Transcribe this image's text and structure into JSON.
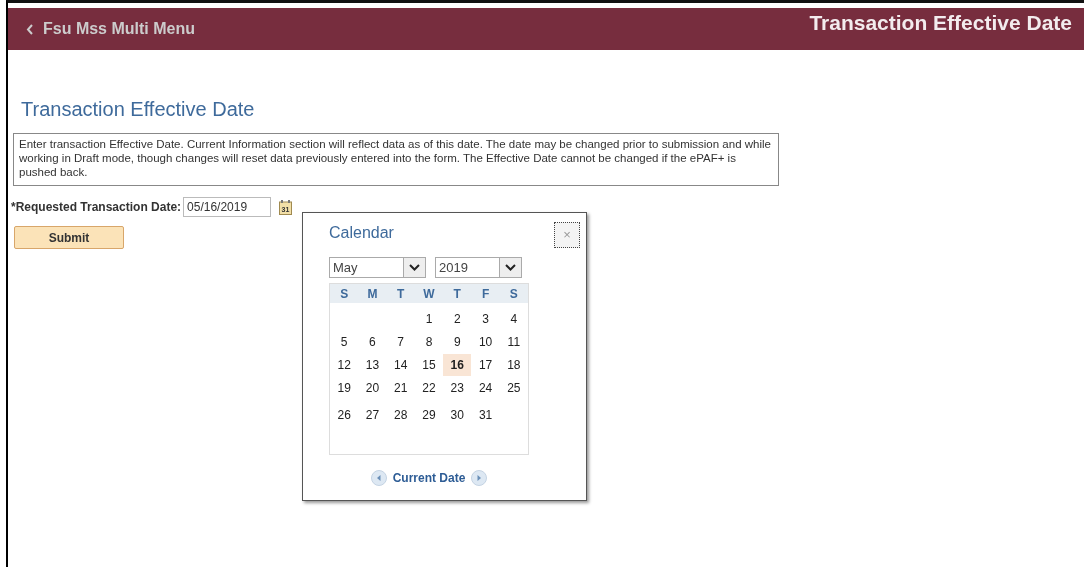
{
  "header": {
    "back_label": "Fsu Mss Multi Menu",
    "title": "Transaction Effective Date"
  },
  "page": {
    "title": "Transaction Effective Date",
    "instructions": "Enter transaction Effective Date. Current Information section will reflect data as of this date. The date may be changed prior to submission and while working in Draft mode, though changes will reset data previously entered into the form. The Effective Date cannot be changed if the ePAF+ is pushed back.",
    "date_label": "*Requested Transaction Date:",
    "date_value": "05/16/2019",
    "calendar_icon_text": "31",
    "submit": "Submit"
  },
  "calendar": {
    "title": "Calendar",
    "close": "×",
    "month": "May",
    "year": "2019",
    "weekdays": [
      "S",
      "M",
      "T",
      "W",
      "T",
      "F",
      "S"
    ],
    "weeks": [
      {
        "kind": "first",
        "days": [
          {
            "day": "1",
            "selected": false
          },
          {
            "day": "2",
            "selected": false
          },
          {
            "day": "3",
            "selected": false
          },
          {
            "day": "4",
            "selected": false
          }
        ]
      },
      {
        "kind": "middle",
        "days": [
          {
            "day": "5",
            "selected": false
          },
          {
            "day": "6",
            "selected": false
          },
          {
            "day": "7",
            "selected": false
          },
          {
            "day": "8",
            "selected": false
          },
          {
            "day": "9",
            "selected": false
          },
          {
            "day": "10",
            "selected": false
          },
          {
            "day": "11",
            "selected": false
          }
        ]
      },
      {
        "kind": "middle",
        "days": [
          {
            "day": "12",
            "selected": false
          },
          {
            "day": "13",
            "selected": false
          },
          {
            "day": "14",
            "selected": false
          },
          {
            "day": "15",
            "selected": false
          },
          {
            "day": "16",
            "selected": true
          },
          {
            "day": "17",
            "selected": false
          },
          {
            "day": "18",
            "selected": false
          }
        ]
      },
      {
        "kind": "middle",
        "days": [
          {
            "day": "19",
            "selected": false
          },
          {
            "day": "20",
            "selected": false
          },
          {
            "day": "21",
            "selected": false
          },
          {
            "day": "22",
            "selected": false
          },
          {
            "day": "23",
            "selected": false
          },
          {
            "day": "24",
            "selected": false
          },
          {
            "day": "25",
            "selected": false
          }
        ]
      },
      {
        "kind": "last",
        "days": [
          {
            "day": "26",
            "selected": false
          },
          {
            "day": "27",
            "selected": false
          },
          {
            "day": "28",
            "selected": false
          },
          {
            "day": "29",
            "selected": false
          },
          {
            "day": "30",
            "selected": false
          },
          {
            "day": "31",
            "selected": false
          }
        ]
      }
    ],
    "current_date": "Current Date"
  }
}
